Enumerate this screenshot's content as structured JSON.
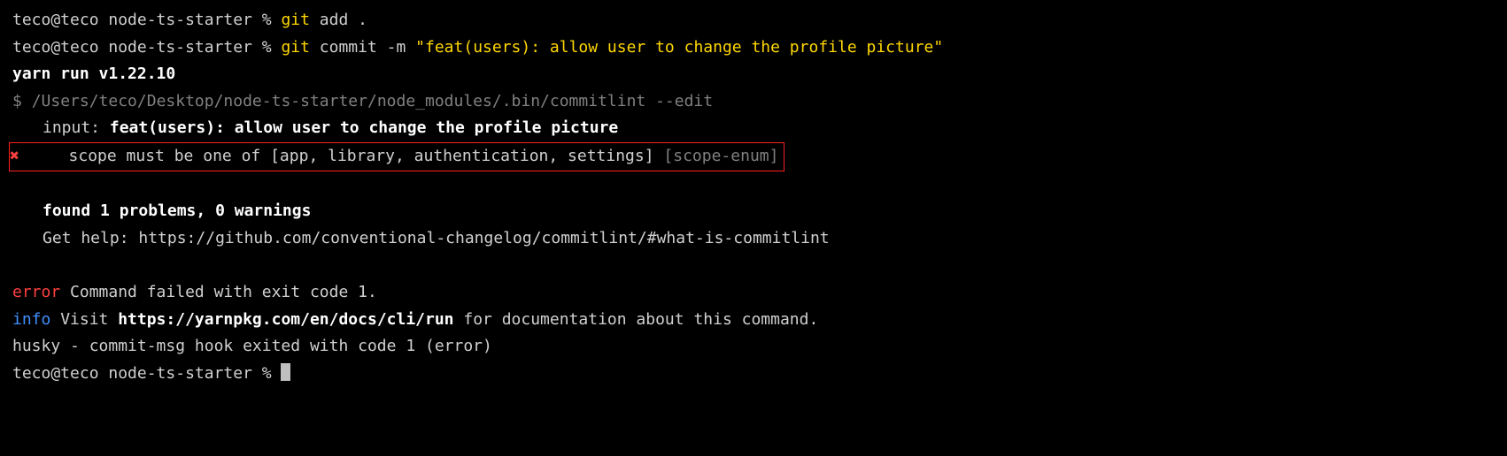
{
  "prompt1": {
    "host": "teco@teco node-ts-starter % ",
    "cmd": "git",
    "args": " add ."
  },
  "prompt2": {
    "host": "teco@teco node-ts-starter % ",
    "cmd": "git",
    "args": " commit -m ",
    "quoted": "\"feat(users): allow user to change the profile picture\""
  },
  "yarn_run": "yarn run v1.22.10",
  "commitlint_path": {
    "dollar": "$ ",
    "path": "/Users/teco/Desktop/node-ts-starter/node_modules/.bin/commitlint --edit"
  },
  "input_line": {
    "marker": "⧗",
    "label": "input: ",
    "msg": "feat(users): allow user to change the profile picture"
  },
  "error_line": {
    "marker": "✖",
    "msg": "scope must be one of [app, library, authentication, settings] ",
    "rule": "[scope-enum]"
  },
  "summary": {
    "marker": "✖",
    "text": "found 1 problems, 0 warnings"
  },
  "help": {
    "marker": "ⓘ",
    "label": "Get help: ",
    "url": "https://github.com/conventional-changelog/commitlint/#what-is-commitlint"
  },
  "yarn_error": {
    "prefix": "error",
    "msg": " Command failed with exit code 1."
  },
  "yarn_info": {
    "prefix": "info",
    "pre": " Visit ",
    "url": "https://yarnpkg.com/en/docs/cli/run",
    "post": " for documentation about this command."
  },
  "husky": "husky - commit-msg hook exited with code 1 (error)",
  "prompt3": {
    "host": "teco@teco node-ts-starter % "
  }
}
